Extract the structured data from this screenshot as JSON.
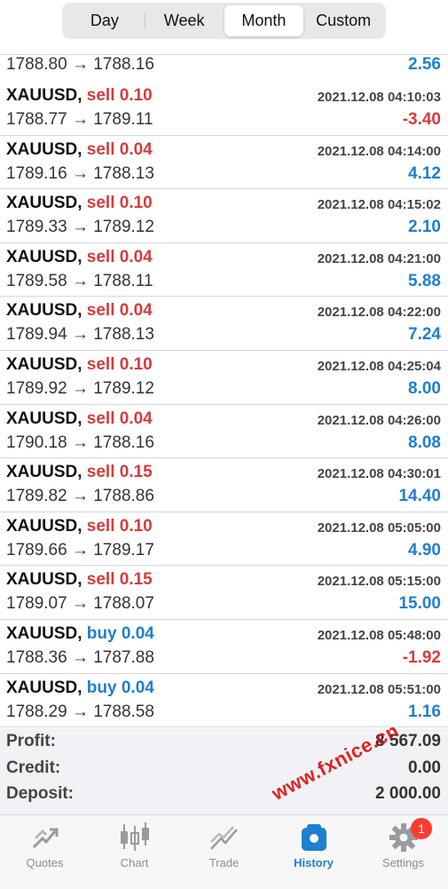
{
  "segments": [
    {
      "label": "Day",
      "active": false
    },
    {
      "label": "Week",
      "active": false
    },
    {
      "label": "Month",
      "active": true
    },
    {
      "label": "Custom",
      "active": false
    }
  ],
  "partial_row": {
    "prices": "1788.80 → 1788.16",
    "profit": "2.56",
    "sign": "pos"
  },
  "trades": [
    {
      "symbol": "XAUUSD,",
      "side": "sell 0.10",
      "type": "sell",
      "time": "2021.12.08 04:10:03",
      "prices": "1788.77 → 1789.11",
      "profit": "-3.40",
      "sign": "neg"
    },
    {
      "symbol": "XAUUSD,",
      "side": "sell 0.04",
      "type": "sell",
      "time": "2021.12.08 04:14:00",
      "prices": "1789.16 → 1788.13",
      "profit": "4.12",
      "sign": "pos"
    },
    {
      "symbol": "XAUUSD,",
      "side": "sell 0.10",
      "type": "sell",
      "time": "2021.12.08 04:15:02",
      "prices": "1789.33 → 1789.12",
      "profit": "2.10",
      "sign": "pos"
    },
    {
      "symbol": "XAUUSD,",
      "side": "sell 0.04",
      "type": "sell",
      "time": "2021.12.08 04:21:00",
      "prices": "1789.58 → 1788.11",
      "profit": "5.88",
      "sign": "pos"
    },
    {
      "symbol": "XAUUSD,",
      "side": "sell 0.04",
      "type": "sell",
      "time": "2021.12.08 04:22:00",
      "prices": "1789.94 → 1788.13",
      "profit": "7.24",
      "sign": "pos"
    },
    {
      "symbol": "XAUUSD,",
      "side": "sell 0.10",
      "type": "sell",
      "time": "2021.12.08 04:25:04",
      "prices": "1789.92 → 1789.12",
      "profit": "8.00",
      "sign": "pos"
    },
    {
      "symbol": "XAUUSD,",
      "side": "sell 0.04",
      "type": "sell",
      "time": "2021.12.08 04:26:00",
      "prices": "1790.18 → 1788.16",
      "profit": "8.08",
      "sign": "pos"
    },
    {
      "symbol": "XAUUSD,",
      "side": "sell 0.15",
      "type": "sell",
      "time": "2021.12.08 04:30:01",
      "prices": "1789.82 → 1788.86",
      "profit": "14.40",
      "sign": "pos"
    },
    {
      "symbol": "XAUUSD,",
      "side": "sell 0.10",
      "type": "sell",
      "time": "2021.12.08 05:05:00",
      "prices": "1789.66 → 1789.17",
      "profit": "4.90",
      "sign": "pos"
    },
    {
      "symbol": "XAUUSD,",
      "side": "sell 0.15",
      "type": "sell",
      "time": "2021.12.08 05:15:00",
      "prices": "1789.07 → 1788.07",
      "profit": "15.00",
      "sign": "pos"
    },
    {
      "symbol": "XAUUSD,",
      "side": "buy 0.04",
      "type": "buy",
      "time": "2021.12.08 05:48:00",
      "prices": "1788.36 → 1787.88",
      "profit": "-1.92",
      "sign": "neg"
    },
    {
      "symbol": "XAUUSD,",
      "side": "buy 0.04",
      "type": "buy",
      "time": "2021.12.08 05:51:00",
      "prices": "1788.29 → 1788.58",
      "profit": "1.16",
      "sign": "pos"
    }
  ],
  "summary": [
    {
      "label": "Profit:",
      "value": "8 567.09"
    },
    {
      "label": "Credit:",
      "value": "0.00"
    },
    {
      "label": "Deposit:",
      "value": "2 000.00"
    }
  ],
  "tabs": [
    {
      "label": "Quotes",
      "icon": "quotes-icon",
      "active": false
    },
    {
      "label": "Chart",
      "icon": "candlestick-chart-icon",
      "active": false
    },
    {
      "label": "Trade",
      "icon": "trade-icon",
      "active": false
    },
    {
      "label": "History",
      "icon": "history-icon",
      "active": true
    },
    {
      "label": "Settings",
      "icon": "gear-icon",
      "active": false
    }
  ],
  "settings_badge": "1",
  "watermark": "www.fxnice.cn",
  "colors": {
    "sell": "#d63b3b",
    "buy": "#1f7fd0",
    "profit_pos": "#1f7fd0",
    "profit_neg": "#d63b3b",
    "badge": "#ff3b30"
  }
}
